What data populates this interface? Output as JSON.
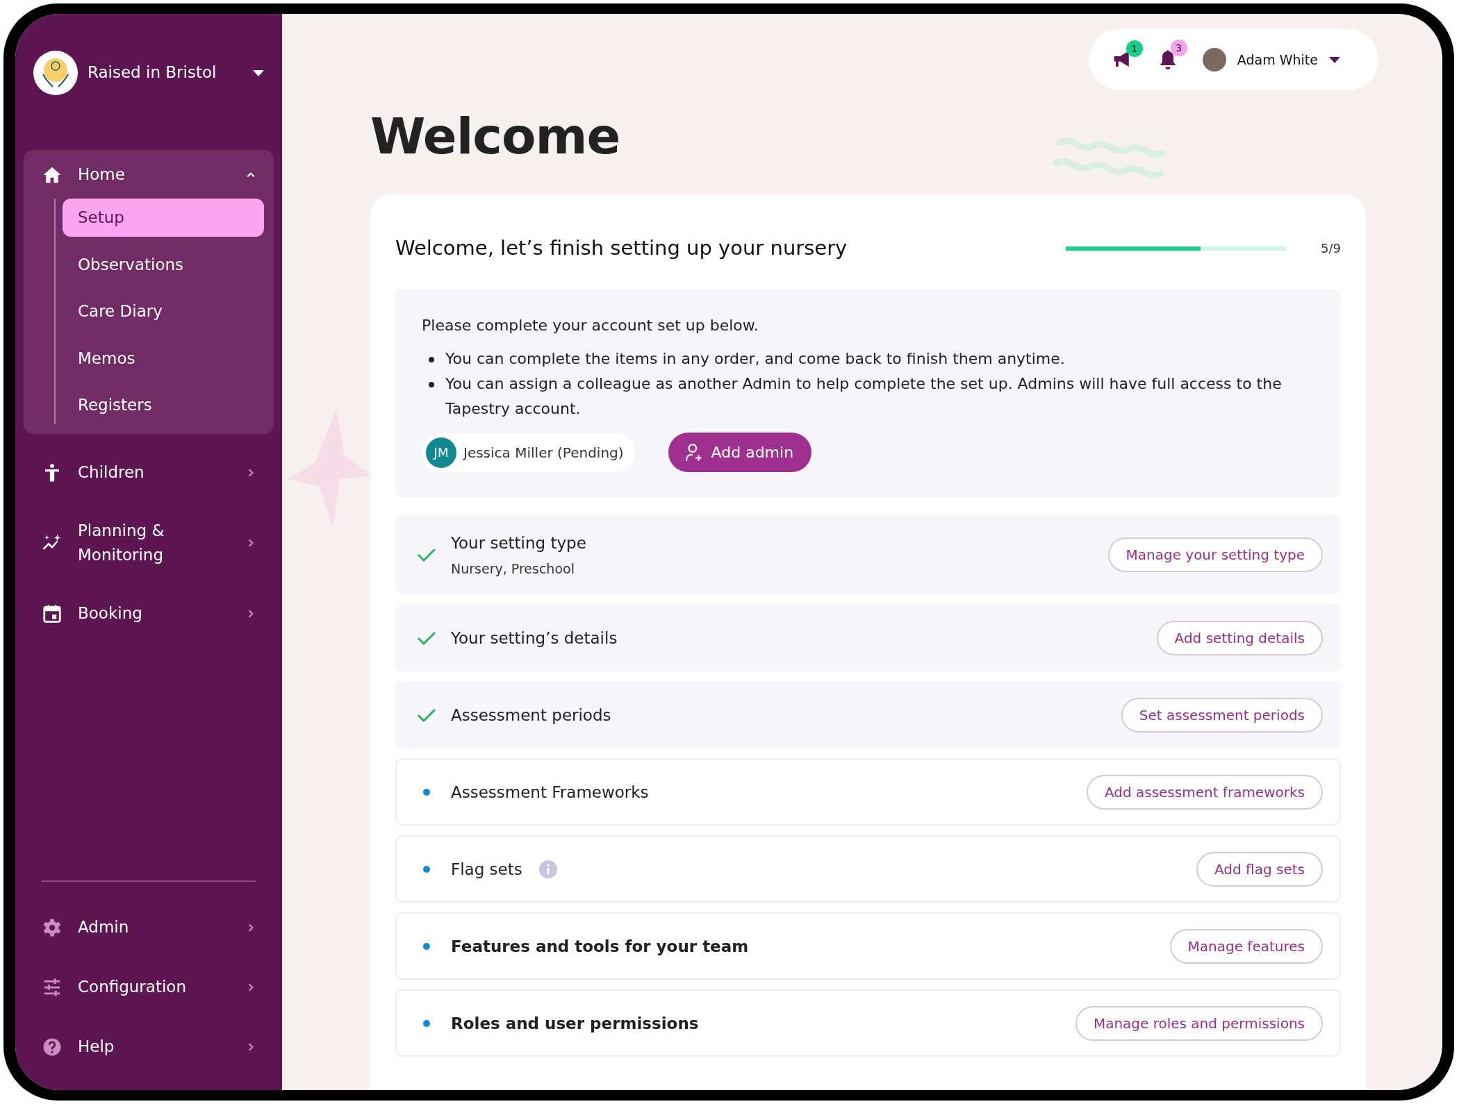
{
  "sidebar": {
    "org_name": "Raised in Bristol",
    "items": [
      {
        "label": "Home",
        "expanded": true,
        "children": [
          {
            "label": "Setup",
            "selected": true
          },
          {
            "label": "Observations",
            "selected": false
          },
          {
            "label": "Care Diary",
            "selected": false
          },
          {
            "label": "Memos",
            "selected": false
          },
          {
            "label": "Registers",
            "selected": false
          }
        ]
      },
      {
        "label": "Children",
        "expanded": false
      },
      {
        "label": "Planning & Monitoring",
        "expanded": false
      },
      {
        "label": "Booking",
        "expanded": false
      }
    ],
    "bottom_items": [
      {
        "label": "Admin",
        "expanded": false
      },
      {
        "label": "Configuration",
        "expanded": false
      },
      {
        "label": "Help",
        "expanded": false
      }
    ]
  },
  "header": {
    "announcements_count": "1",
    "notifications_count": "3",
    "user_name": "Adam White"
  },
  "title": "Welcome",
  "setup_card": {
    "title": "Welcome, let’s finish setting up your nursery",
    "progress": {
      "level": 0.61,
      "reading": "5/9"
    },
    "intro": "Please complete your account set up below.",
    "bullets": [
      "You can complete the items in any order, and come back to finish them anytime.",
      "You can assign a colleague as another Admin to help complete the set up. Admins will have full access to the Tapestry account."
    ],
    "admin_chip": {
      "initials": "JM",
      "label": "Jessica Miller (Pending)"
    },
    "add_admin_button": "Add admin",
    "tasks": [
      {
        "label": "Your setting type",
        "detail": "Nursery, Preschool",
        "done": true,
        "bold": false,
        "info": false,
        "action": "Manage your setting type"
      },
      {
        "label": "Your setting’s details",
        "done": true,
        "bold": false,
        "info": false,
        "action": "Add setting details"
      },
      {
        "label": "Assessment periods",
        "done": true,
        "bold": false,
        "info": false,
        "action": "Set assessment periods"
      },
      {
        "label": "Assessment Frameworks",
        "done": false,
        "bold": false,
        "info": false,
        "action": "Add assessment frameworks"
      },
      {
        "label": "Flag sets",
        "done": false,
        "bold": false,
        "info": true,
        "action": "Add flag sets"
      },
      {
        "label": "Features and tools for your team",
        "done": false,
        "bold": true,
        "info": false,
        "action": "Manage features"
      },
      {
        "label": "Roles and user permissions",
        "done": false,
        "bold": true,
        "info": false,
        "action": "Manage roles and permissions"
      }
    ]
  }
}
